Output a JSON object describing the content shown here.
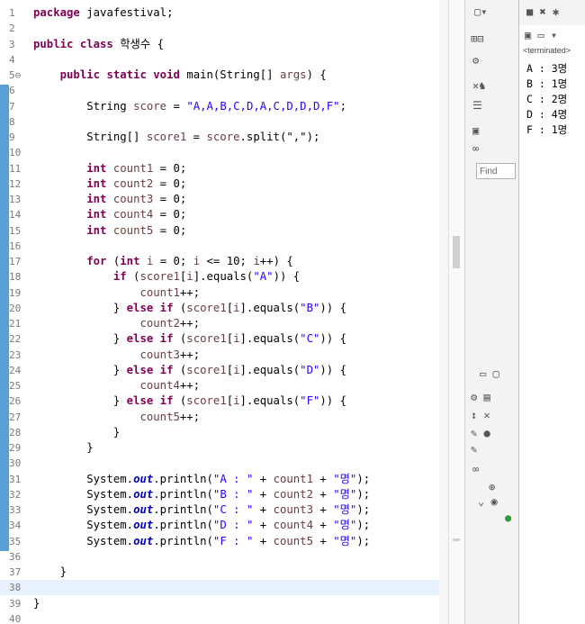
{
  "editor": {
    "lines": [
      {
        "n": "1",
        "t": [
          [
            "k",
            "package"
          ],
          [
            "p",
            " javafestival;"
          ]
        ]
      },
      {
        "n": "2",
        "t": []
      },
      {
        "n": "3",
        "t": [
          [
            "k",
            "public class"
          ],
          [
            "p",
            " 학생수 {"
          ]
        ]
      },
      {
        "n": "4",
        "t": []
      },
      {
        "n": "5⊖",
        "t": [
          [
            "p",
            "    "
          ],
          [
            "k",
            "public static void"
          ],
          [
            "p",
            " main(String[] "
          ],
          [
            "v",
            "args"
          ],
          [
            "p",
            ") {"
          ]
        ]
      },
      {
        "n": "6",
        "t": []
      },
      {
        "n": "7",
        "t": [
          [
            "p",
            "        String "
          ],
          [
            "v",
            "score"
          ],
          [
            "p",
            " = "
          ],
          [
            "s",
            "\"A,A,B,C,D,A,C,D,D,D,F\""
          ],
          [
            "p",
            ";"
          ]
        ]
      },
      {
        "n": "8",
        "t": []
      },
      {
        "n": "9",
        "t": [
          [
            "p",
            "        String[] "
          ],
          [
            "v",
            "score1"
          ],
          [
            "p",
            " = "
          ],
          [
            "v",
            "score"
          ],
          [
            "p",
            ".split(\",\");"
          ]
        ]
      },
      {
        "n": "10",
        "t": []
      },
      {
        "n": "11",
        "t": [
          [
            "p",
            "        "
          ],
          [
            "k",
            "int"
          ],
          [
            "p",
            " "
          ],
          [
            "v",
            "count1"
          ],
          [
            "p",
            " = 0;"
          ]
        ]
      },
      {
        "n": "12",
        "t": [
          [
            "p",
            "        "
          ],
          [
            "k",
            "int"
          ],
          [
            "p",
            " "
          ],
          [
            "v",
            "count2"
          ],
          [
            "p",
            " = 0;"
          ]
        ]
      },
      {
        "n": "13",
        "t": [
          [
            "p",
            "        "
          ],
          [
            "k",
            "int"
          ],
          [
            "p",
            " "
          ],
          [
            "v",
            "count3"
          ],
          [
            "p",
            " = 0;"
          ]
        ]
      },
      {
        "n": "14",
        "t": [
          [
            "p",
            "        "
          ],
          [
            "k",
            "int"
          ],
          [
            "p",
            " "
          ],
          [
            "v",
            "count4"
          ],
          [
            "p",
            " = 0;"
          ]
        ]
      },
      {
        "n": "15",
        "t": [
          [
            "p",
            "        "
          ],
          [
            "k",
            "int"
          ],
          [
            "p",
            " "
          ],
          [
            "v",
            "count5"
          ],
          [
            "p",
            " = 0;"
          ]
        ]
      },
      {
        "n": "16",
        "t": []
      },
      {
        "n": "17",
        "t": [
          [
            "p",
            "        "
          ],
          [
            "k",
            "for"
          ],
          [
            "p",
            " ("
          ],
          [
            "k",
            "int"
          ],
          [
            "p",
            " "
          ],
          [
            "v",
            "i"
          ],
          [
            "p",
            " = 0; "
          ],
          [
            "v",
            "i"
          ],
          [
            "p",
            " <= 10; "
          ],
          [
            "v",
            "i"
          ],
          [
            "p",
            "++) {"
          ]
        ]
      },
      {
        "n": "18",
        "t": [
          [
            "p",
            "            "
          ],
          [
            "k",
            "if"
          ],
          [
            "p",
            " ("
          ],
          [
            "v",
            "score1"
          ],
          [
            "p",
            "["
          ],
          [
            "v",
            "i"
          ],
          [
            "p",
            "].equals("
          ],
          [
            "s",
            "\"A\""
          ],
          [
            "p",
            ")) {"
          ]
        ]
      },
      {
        "n": "19",
        "t": [
          [
            "p",
            "                "
          ],
          [
            "v",
            "count1"
          ],
          [
            "p",
            "++;"
          ]
        ]
      },
      {
        "n": "20",
        "t": [
          [
            "p",
            "            } "
          ],
          [
            "k",
            "else if"
          ],
          [
            "p",
            " ("
          ],
          [
            "v",
            "score1"
          ],
          [
            "p",
            "["
          ],
          [
            "v",
            "i"
          ],
          [
            "p",
            "].equals("
          ],
          [
            "s",
            "\"B\""
          ],
          [
            "p",
            ")) {"
          ]
        ]
      },
      {
        "n": "21",
        "t": [
          [
            "p",
            "                "
          ],
          [
            "v",
            "count2"
          ],
          [
            "p",
            "++;"
          ]
        ]
      },
      {
        "n": "22",
        "t": [
          [
            "p",
            "            } "
          ],
          [
            "k",
            "else if"
          ],
          [
            "p",
            " ("
          ],
          [
            "v",
            "score1"
          ],
          [
            "p",
            "["
          ],
          [
            "v",
            "i"
          ],
          [
            "p",
            "].equals("
          ],
          [
            "s",
            "\"C\""
          ],
          [
            "p",
            ")) {"
          ]
        ]
      },
      {
        "n": "23",
        "t": [
          [
            "p",
            "                "
          ],
          [
            "v",
            "count3"
          ],
          [
            "p",
            "++;"
          ]
        ]
      },
      {
        "n": "24",
        "t": [
          [
            "p",
            "            } "
          ],
          [
            "k",
            "else if"
          ],
          [
            "p",
            " ("
          ],
          [
            "v",
            "score1"
          ],
          [
            "p",
            "["
          ],
          [
            "v",
            "i"
          ],
          [
            "p",
            "].equals("
          ],
          [
            "s",
            "\"D\""
          ],
          [
            "p",
            ")) {"
          ]
        ]
      },
      {
        "n": "25",
        "t": [
          [
            "p",
            "                "
          ],
          [
            "v",
            "count4"
          ],
          [
            "p",
            "++;"
          ]
        ]
      },
      {
        "n": "26",
        "t": [
          [
            "p",
            "            } "
          ],
          [
            "k",
            "else if"
          ],
          [
            "p",
            " ("
          ],
          [
            "v",
            "score1"
          ],
          [
            "p",
            "["
          ],
          [
            "v",
            "i"
          ],
          [
            "p",
            "].equals("
          ],
          [
            "s",
            "\"F\""
          ],
          [
            "p",
            ")) {"
          ]
        ]
      },
      {
        "n": "27",
        "t": [
          [
            "p",
            "                "
          ],
          [
            "v",
            "count5"
          ],
          [
            "p",
            "++;"
          ]
        ]
      },
      {
        "n": "28",
        "t": [
          [
            "p",
            "            }"
          ]
        ]
      },
      {
        "n": "29",
        "t": [
          [
            "p",
            "        }"
          ]
        ]
      },
      {
        "n": "30",
        "t": []
      },
      {
        "n": "31",
        "t": [
          [
            "p",
            "        System."
          ],
          [
            "st",
            "out"
          ],
          [
            "p",
            ".println("
          ],
          [
            "s",
            "\"A : \""
          ],
          [
            "p",
            " + "
          ],
          [
            "v",
            "count1"
          ],
          [
            "p",
            " + "
          ],
          [
            "s",
            "\"명\""
          ],
          [
            "p",
            ");"
          ]
        ]
      },
      {
        "n": "32",
        "t": [
          [
            "p",
            "        System."
          ],
          [
            "st",
            "out"
          ],
          [
            "p",
            ".println("
          ],
          [
            "s",
            "\"B : \""
          ],
          [
            "p",
            " + "
          ],
          [
            "v",
            "count2"
          ],
          [
            "p",
            " + "
          ],
          [
            "s",
            "\"명\""
          ],
          [
            "p",
            ");"
          ]
        ]
      },
      {
        "n": "33",
        "t": [
          [
            "p",
            "        System."
          ],
          [
            "st",
            "out"
          ],
          [
            "p",
            ".println("
          ],
          [
            "s",
            "\"C : \""
          ],
          [
            "p",
            " + "
          ],
          [
            "v",
            "count3"
          ],
          [
            "p",
            " + "
          ],
          [
            "s",
            "\"명\""
          ],
          [
            "p",
            ");"
          ]
        ]
      },
      {
        "n": "34",
        "t": [
          [
            "p",
            "        System."
          ],
          [
            "st",
            "out"
          ],
          [
            "p",
            ".println("
          ],
          [
            "s",
            "\"D : \""
          ],
          [
            "p",
            " + "
          ],
          [
            "v",
            "count4"
          ],
          [
            "p",
            " + "
          ],
          [
            "s",
            "\"명\""
          ],
          [
            "p",
            ");"
          ]
        ]
      },
      {
        "n": "35",
        "t": [
          [
            "p",
            "        System."
          ],
          [
            "st",
            "out"
          ],
          [
            "p",
            ".println("
          ],
          [
            "s",
            "\"F : \""
          ],
          [
            "p",
            " + "
          ],
          [
            "v",
            "count5"
          ],
          [
            "p",
            " + "
          ],
          [
            "s",
            "\"명\""
          ],
          [
            "p",
            ");"
          ]
        ]
      },
      {
        "n": "36",
        "t": []
      },
      {
        "n": "37",
        "t": [
          [
            "p",
            "    }"
          ]
        ]
      },
      {
        "n": "38",
        "t": []
      },
      {
        "n": "39",
        "t": [
          [
            "p",
            "}"
          ]
        ]
      },
      {
        "n": "40",
        "t": []
      }
    ],
    "highlighted_line": "38"
  },
  "side": {
    "find_placeholder": "Find"
  },
  "console": {
    "status": "<terminated>",
    "output": [
      "A : 3명",
      "B : 1명",
      "C : 2명",
      "D : 4명",
      "F : 1명"
    ]
  }
}
